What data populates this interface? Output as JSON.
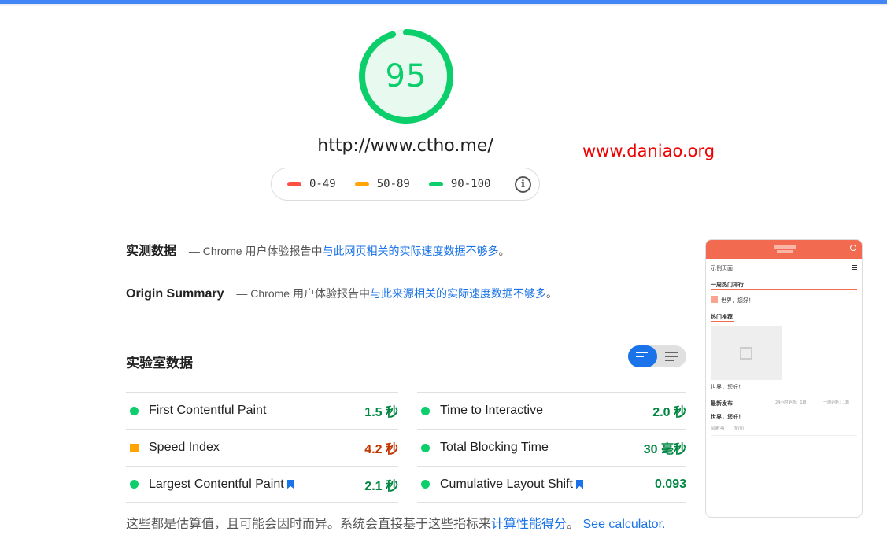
{
  "score": "95",
  "url": "http://www.ctho.me/",
  "watermark": "www.daniao.org",
  "legend": {
    "ranges": [
      {
        "label": "0-49",
        "color": "#ff4e42"
      },
      {
        "label": "50-89",
        "color": "#ffa400"
      },
      {
        "label": "90-100",
        "color": "#0cce6b"
      }
    ],
    "info_icon": "i"
  },
  "field_data": {
    "title": "实测数据",
    "prefix": "— Chrome 用户体验报告中",
    "link": "与此网页相关的实际速度数据不够多",
    "suffix": "。"
  },
  "origin_summary": {
    "title": "Origin Summary",
    "prefix": "— Chrome 用户体验报告中",
    "link": "与此来源相关的实际速度数据不够多",
    "suffix": "。"
  },
  "lab_data": {
    "title": "实验室数据",
    "metrics_left": [
      {
        "label": "First Contentful Paint",
        "value": "1.5 秒",
        "rating": "good",
        "bookmark": false
      },
      {
        "label": "Speed Index",
        "value": "4.2 秒",
        "rating": "average",
        "bookmark": false
      },
      {
        "label": "Largest Contentful Paint",
        "value": "2.1 秒",
        "rating": "good",
        "bookmark": true
      }
    ],
    "metrics_right": [
      {
        "label": "Time to Interactive",
        "value": "2.0 秒",
        "rating": "good",
        "bookmark": false
      },
      {
        "label": "Total Blocking Time",
        "value": "30 毫秒",
        "rating": "good",
        "bookmark": false
      },
      {
        "label": "Cumulative Layout Shift",
        "value": "0.093",
        "rating": "good",
        "bookmark": true
      }
    ]
  },
  "footer": {
    "text": "这些都是估算值，且可能会因时而异。系统会直接基于这些指标来",
    "link1": "计算性能得分",
    "sep": "。",
    "link2": "See calculator."
  },
  "preview": {
    "nav_title": "示例页面",
    "section1": "一周热门排行",
    "item1": "世界，您好！",
    "section2": "热门推荐",
    "item2": "世界，您好！",
    "section3": "最新发布",
    "tab1": "24小时更新：1篇",
    "tab2": "一周更新：1篇",
    "item3": "世界，您好！",
    "meta1": "阅读(4)",
    "meta2": "赞(0)"
  },
  "colors": {
    "good": "#0cce6b",
    "average": "#ffa400",
    "poor": "#ff4e42",
    "link": "#1a73e8"
  }
}
